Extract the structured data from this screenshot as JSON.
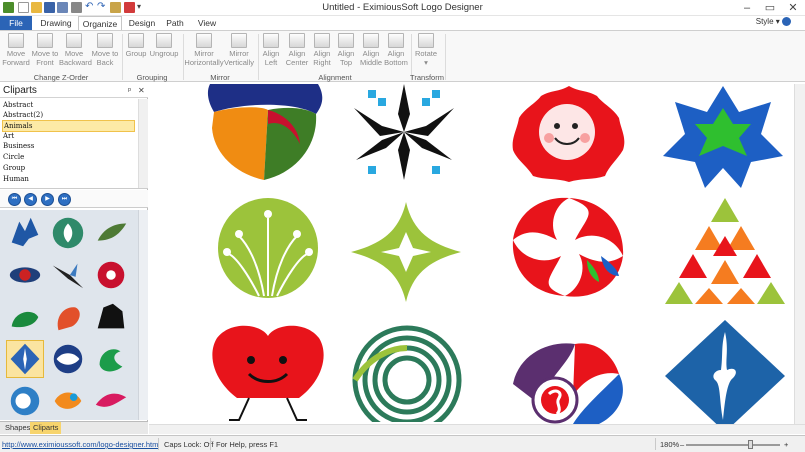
{
  "window": {
    "title": "Untitled - EximiousSoft Logo Designer"
  },
  "tabs": {
    "file": "File",
    "drawing": "Drawing",
    "organize": "Organize",
    "design": "Design",
    "path": "Path",
    "view": "View",
    "style": "Style"
  },
  "ribbon": {
    "move_forward": [
      "Move",
      "Forward"
    ],
    "move_to_front": [
      "Move to",
      "Front"
    ],
    "move_backward": [
      "Move",
      "Backward"
    ],
    "move_to_back": [
      "Move to",
      "Back"
    ],
    "group": [
      "Group",
      ""
    ],
    "ungroup": [
      "Ungroup",
      ""
    ],
    "mirror_h": [
      "Mirror",
      "Horizontally"
    ],
    "mirror_v": [
      "Mirror",
      "Vertically"
    ],
    "align_left": [
      "Align",
      "Left"
    ],
    "align_center": [
      "Align",
      "Center"
    ],
    "align_right": [
      "Align",
      "Right"
    ],
    "align_top": [
      "Align",
      "Top"
    ],
    "align_middle": [
      "Align",
      "Middle"
    ],
    "align_bottom": [
      "Align",
      "Bottom"
    ],
    "rotate": [
      "Rotate",
      "▾"
    ],
    "groups": {
      "zorder": "Change Z-Order",
      "grouping": "Grouping",
      "mirror": "Mirror",
      "alignment": "Alignment",
      "transform": "Transform"
    }
  },
  "panel": {
    "title": "Cliparts",
    "pin": "ᵖ",
    "close": "✕",
    "categories": [
      "Abstract",
      "Abstract(2)",
      "Animals",
      "Art",
      "Business",
      "Circle",
      "Group",
      "Human"
    ],
    "selected_category": "Animals",
    "tabs": {
      "shapes": "Shapes",
      "cliparts": "Cliparts"
    }
  },
  "status": {
    "link": "http://www.eximioussoft.com/logo-designer.htm",
    "caps": "Caps Lock: Off",
    "help": "For Help, press F1",
    "zoom": "180%"
  },
  "colors": {
    "accent": "#2b64b6",
    "selection": "#fbe4a0"
  }
}
